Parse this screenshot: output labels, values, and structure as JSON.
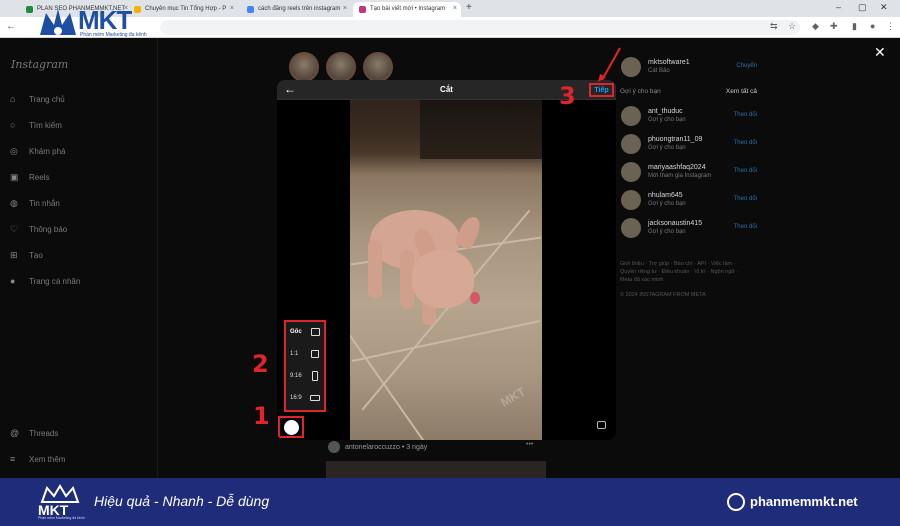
{
  "browser": {
    "tabs": [
      {
        "label": "PLAN SEO PHANMEMMKT.NET",
        "active": false,
        "color": "#1e8e3e"
      },
      {
        "label": "Chuyên mục Tin Tổng Hợp - P",
        "active": false,
        "color": "#f4b400"
      },
      {
        "label": "cách đăng reels trên instagram",
        "active": false,
        "color": "#4285f4"
      },
      {
        "label": "Tạo bài viết mới • Instagram",
        "active": true,
        "color": "#c13584"
      }
    ],
    "new_tab": "+"
  },
  "mkt_logo": {
    "text": "MKT",
    "subtitle": "Phần mềm Marketing đa kênh"
  },
  "instagram": {
    "logo": "Instagram",
    "nav": [
      {
        "icon": "home-icon",
        "glyph": "⌂",
        "label": "Trang chủ"
      },
      {
        "icon": "search-icon",
        "glyph": "○",
        "label": "Tìm kiếm"
      },
      {
        "icon": "compass-icon",
        "glyph": "◎",
        "label": "Khám phá"
      },
      {
        "icon": "reels-icon",
        "glyph": "▣",
        "label": "Reels"
      },
      {
        "icon": "messenger-icon",
        "glyph": "◍",
        "label": "Tin nhắn"
      },
      {
        "icon": "heart-icon",
        "glyph": "♡",
        "label": "Thông báo"
      },
      {
        "icon": "create-icon",
        "glyph": "⊞",
        "label": "Tạo"
      },
      {
        "icon": "profile-icon",
        "glyph": "●",
        "label": "Trang cá nhân"
      }
    ],
    "bottom_nav": [
      {
        "icon": "threads-icon",
        "glyph": "@",
        "label": "Threads"
      },
      {
        "icon": "menu-icon",
        "glyph": "≡",
        "label": "Xem thêm"
      }
    ],
    "post": {
      "author": "antonelaroccuzzo",
      "time": "• 3 ngày",
      "more": "•••"
    },
    "current_user": {
      "name": "mktsoftware1",
      "sub": "Cát Bảo",
      "action": "Chuyển"
    },
    "suggestions_header": "Gợi ý cho bạn",
    "see_all": "Xem tất cả",
    "suggestions": [
      {
        "name": "ant_thuduc",
        "sub": "Gợi ý cho bạn",
        "action": "Theo dõi"
      },
      {
        "name": "phuongtran11_09",
        "sub": "Gợi ý cho bạn",
        "action": "Theo dõi"
      },
      {
        "name": "mariyaashfaq2024",
        "sub": "Mới tham gia Instagram",
        "action": "Theo dõi"
      },
      {
        "name": "nhulam645",
        "sub": "Gợi ý cho bạn",
        "action": "Theo dõi"
      },
      {
        "name": "jacksonaustin415",
        "sub": "Gợi ý cho bạn",
        "action": "Theo dõi"
      }
    ],
    "footer_links": "Giới thiệu · Trợ giúp · Báo chí · API · Việc làm · Quyền riêng tư · Điều khoản · Vị trí · Ngôn ngữ · Meta đã xác minh",
    "copyright": "© 2024 INSTAGRAM FROM META"
  },
  "modal": {
    "title": "Cắt",
    "next_label": "Tiếp",
    "ratios": [
      {
        "label": "Gốc",
        "icon": "image-icon"
      },
      {
        "label": "1:1",
        "icon": "square-icon"
      },
      {
        "label": "9:16",
        "icon": "portrait-icon"
      },
      {
        "label": "16:9",
        "icon": "landscape-icon"
      }
    ],
    "video_watermark": "MKT"
  },
  "annotations": {
    "step1": "1",
    "step2": "2",
    "step3": "3",
    "color": "#e0242b"
  },
  "promo": {
    "logo": "MKT",
    "logo_sub": "Phần mềm Marketing đa kênh",
    "tagline": "Hiệu quả - Nhanh - Dễ dùng",
    "website": "phanmemmkt.net",
    "bg_color": "#1e2c7a"
  }
}
